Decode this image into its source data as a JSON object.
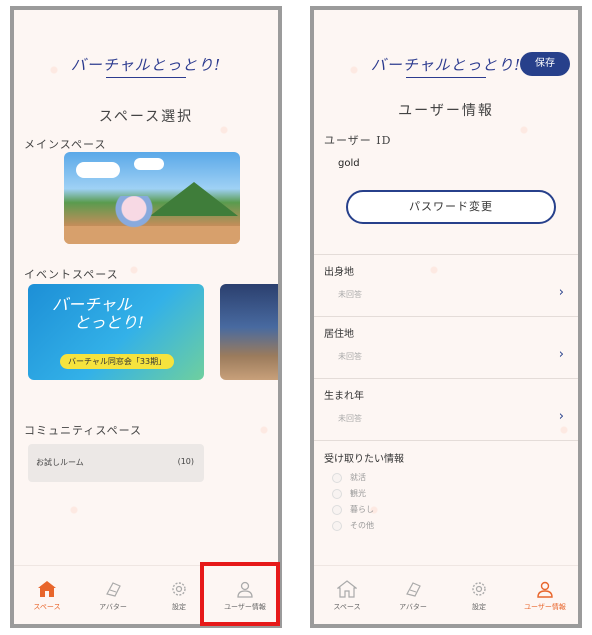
{
  "logo_text": "バーチャルとっとり!",
  "screen1": {
    "title": "スペース選択",
    "main_space_label": "メインスペース",
    "event_space_label": "イベントスペース",
    "event_card": {
      "title_line1": "バーチャル",
      "title_line2": "とっとり!",
      "pill": "バーチャル同窓会「33期」"
    },
    "community_label": "コミュニティスペース",
    "community_items": [
      {
        "name": "お試しルーム",
        "count": "(10)"
      }
    ]
  },
  "screen2": {
    "title": "ユーザー情報",
    "save_label": "保存",
    "user_id_label": "ユーザー ID",
    "user_id_value": "gold",
    "password_button": "パスワード変更",
    "fields": [
      {
        "label": "出身地",
        "value": "未回答"
      },
      {
        "label": "居住地",
        "value": "未回答"
      },
      {
        "label": "生まれ年",
        "value": "未回答"
      }
    ],
    "receive_label": "受け取りたい情報",
    "receive_options": [
      "就活",
      "観光",
      "暮らし",
      "その他"
    ]
  },
  "nav": [
    {
      "label": "スペース",
      "icon": "home-icon"
    },
    {
      "label": "アバター",
      "icon": "avatar-icon"
    },
    {
      "label": "設定",
      "icon": "gear-icon"
    },
    {
      "label": "ユーザー情報",
      "icon": "user-icon"
    }
  ],
  "colors": {
    "accent": "#e8662c",
    "brand": "#27408b",
    "highlight": "#e61919"
  }
}
